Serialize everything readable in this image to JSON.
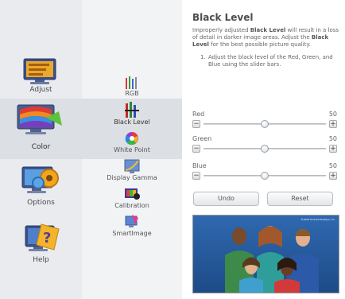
{
  "categories": [
    {
      "id": "adjust",
      "label": "Adjust",
      "icon": "adjust-monitor-icon"
    },
    {
      "id": "color",
      "label": "Color",
      "icon": "color-monitor-icon",
      "active": true
    },
    {
      "id": "options",
      "label": "Options",
      "icon": "options-gear-icon"
    },
    {
      "id": "help",
      "label": "Help",
      "icon": "help-question-icon"
    }
  ],
  "subitems": [
    {
      "id": "rgb",
      "label": "RGB",
      "icon": "rgb-bars-icon"
    },
    {
      "id": "black-level",
      "label": "Black Level",
      "icon": "black-level-bars-icon",
      "active": true
    },
    {
      "id": "white-point",
      "label": "White Point",
      "icon": "color-wheel-icon"
    },
    {
      "id": "display-gamma",
      "label": "Display Gamma",
      "icon": "gamma-curve-icon"
    },
    {
      "id": "calibration",
      "label": "Calibration",
      "icon": "calibration-icon"
    },
    {
      "id": "smartimage",
      "label": "SmartImage",
      "icon": "smartimage-icon"
    }
  ],
  "content": {
    "title": "Black Level",
    "description": {
      "p1": "Improperly adjusted ",
      "b1": "Black Level",
      "p2": " will result in a loss of detail in darker image areas. Adjust the ",
      "b2": "Black Level",
      "p3": " for the best possible picture quality."
    },
    "step": {
      "number": "1.",
      "text": "Adjust the black level of the Red, Green, and Blue using the slider bars."
    }
  },
  "sliders": [
    {
      "id": "red",
      "label": "Red",
      "value": 50,
      "min": 0,
      "max": 100,
      "minus": "−",
      "plus": "+"
    },
    {
      "id": "green",
      "label": "Green",
      "value": 50,
      "min": 0,
      "max": 100,
      "minus": "−",
      "plus": "+"
    },
    {
      "id": "blue",
      "label": "Blue",
      "value": 50,
      "min": 0,
      "max": 100,
      "minus": "−",
      "plus": "+"
    }
  ],
  "buttons": {
    "undo": "Undo",
    "reset": "Reset"
  },
  "photo": {
    "caption": "©2008 Portrait Displays, Inc."
  },
  "colors": {
    "panel": "#e9ebee",
    "subpanel": "#f2f3f5",
    "active": "#dcdfe3"
  }
}
